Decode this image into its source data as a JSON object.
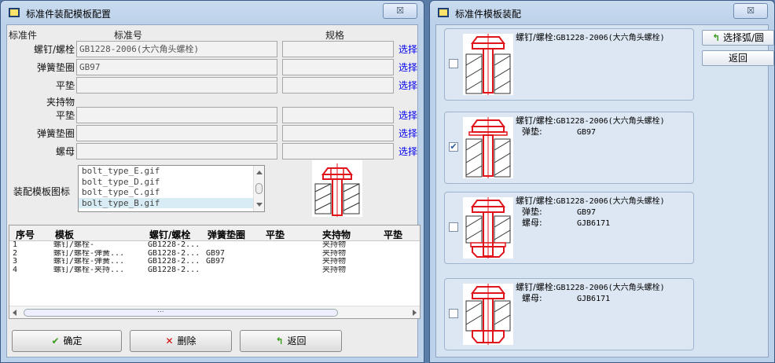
{
  "left_window": {
    "title": "标准件装配模板配置",
    "close_glyph": "☒",
    "headers": {
      "part": "标准件",
      "standard": "标准号",
      "spec": "规格"
    },
    "rows": [
      {
        "label": "螺钉/螺栓",
        "standard": "GB1228-2006(大六角头螺栓)",
        "spec": "",
        "select": "选择"
      },
      {
        "label": "弹簧垫圈",
        "standard": "GB97",
        "spec": "",
        "select": "选择"
      },
      {
        "label": "平垫",
        "standard": "",
        "spec": "",
        "select": "选择"
      },
      {
        "label": "平垫",
        "standard": "",
        "spec": "",
        "select": "选择"
      },
      {
        "label": "弹簧垫圈",
        "standard": "",
        "spec": "",
        "select": "选择"
      },
      {
        "label": "螺母",
        "standard": "",
        "spec": "",
        "select": "选择"
      }
    ],
    "clamp_label": "夹持物",
    "template_label": "装配模板图标",
    "template_files": [
      "bolt_type_E.gif",
      "bolt_type_D.gif",
      "bolt_type_C.gif",
      "bolt_type_B.gif"
    ],
    "template_selected_index": 3,
    "table": {
      "columns": [
        "序号",
        "模板",
        "螺钉/螺栓",
        "弹簧垫圈",
        "平垫",
        "夹持物",
        "平垫"
      ],
      "rows": [
        [
          "1",
          "螺钉/螺栓-",
          "GB1228-2...",
          "",
          "",
          "夹持物",
          ""
        ],
        [
          "2",
          "螺钉/螺栓-弹簧...",
          "GB1228-2...",
          "GB97",
          "",
          "夹持物",
          ""
        ],
        [
          "3",
          "螺钉/螺栓-弹簧...",
          "GB1228-2...",
          "GB97",
          "",
          "夹持物",
          ""
        ],
        [
          "4",
          "螺钉/螺栓-夹持...",
          "GB1228-2...",
          "",
          "",
          "夹持物",
          ""
        ]
      ],
      "scroll_dots": "..."
    },
    "buttons": {
      "ok": "确定",
      "delete": "删除",
      "back": "返回"
    }
  },
  "right_window": {
    "title": "标准件模板装配",
    "close_glyph": "☒",
    "buttons": {
      "select_arc": "选择弧/圆",
      "back": "返回"
    },
    "cards": [
      {
        "checked": false,
        "lines": [
          {
            "k": "螺钉/螺栓:",
            "v": "GB1228-2006(大六角头螺栓)"
          }
        ]
      },
      {
        "checked": true,
        "lines": [
          {
            "k": "螺钉/螺栓:",
            "v": "GB1228-2006(大六角头螺栓)"
          },
          {
            "k": "弹垫:",
            "v": "GB97"
          }
        ]
      },
      {
        "checked": false,
        "lines": [
          {
            "k": "螺钉/螺栓:",
            "v": "GB1228-2006(大六角头螺栓)"
          },
          {
            "k": "弹垫:",
            "v": "GB97"
          },
          {
            "k": "螺母:",
            "v": "GJB6171"
          }
        ]
      },
      {
        "checked": false,
        "lines": [
          {
            "k": "螺钉/螺栓:",
            "v": "GB1228-2006(大六角头螺栓)"
          },
          {
            "k": "螺母:",
            "v": "GJB6171"
          }
        ]
      }
    ]
  },
  "colors": {
    "accent_red": "#e0141b",
    "link_blue": "#0000ee",
    "check_blue": "#2b5e9e"
  },
  "icons": {
    "ok": "check-icon",
    "delete": "x-icon",
    "back": "return-arrow-icon"
  }
}
